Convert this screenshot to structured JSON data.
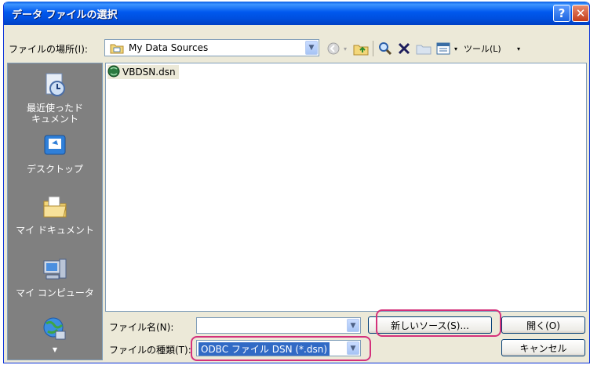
{
  "window": {
    "title": "データ ファイルの選択",
    "help_glyph": "?",
    "close_glyph": "✕"
  },
  "look_in": {
    "label": "ファイルの場所(I):",
    "value": "My Data Sources"
  },
  "toolbar": {
    "tools_label": "ツール(L)"
  },
  "places": [
    {
      "icon": "recent-documents-icon",
      "label": "最近使ったド\nキュメント"
    },
    {
      "icon": "desktop-icon",
      "label": "デスクトップ"
    },
    {
      "icon": "my-documents-icon",
      "label": "マイ ドキュメント"
    },
    {
      "icon": "my-computer-icon",
      "label": "マイ コンピュータ"
    },
    {
      "icon": "network-places-icon",
      "label": ""
    }
  ],
  "files": [
    {
      "name": "VBDSN.dsn",
      "icon": "dsn-file-icon"
    }
  ],
  "file_name": {
    "label": "ファイル名(N):",
    "value": ""
  },
  "file_type": {
    "label": "ファイルの種類(T):",
    "value": "ODBC ファイル DSN (*.dsn)"
  },
  "buttons": {
    "new_source": "新しいソース(S)...",
    "open": "開く(O)",
    "cancel": "キャンセル"
  },
  "colors": {
    "title_bar": "#0058ee",
    "highlight": "#d4317b",
    "dialog_bg": "#ece9d8"
  }
}
